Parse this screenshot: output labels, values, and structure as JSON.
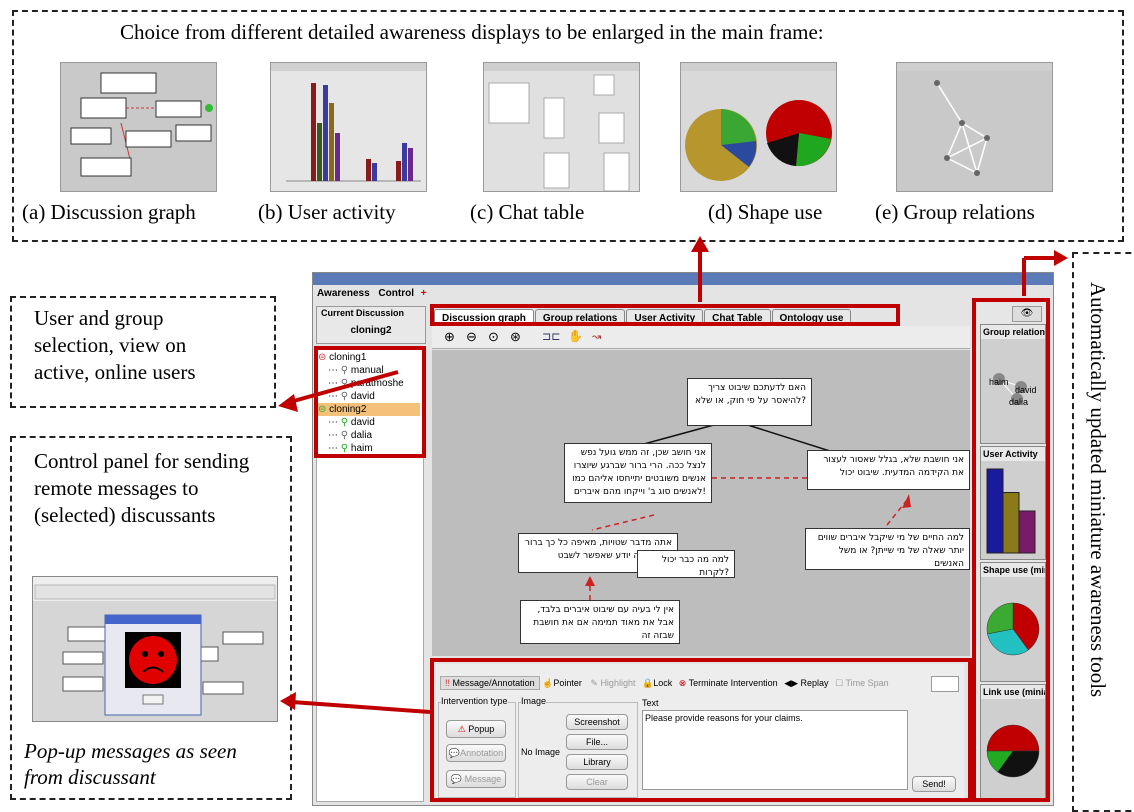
{
  "top_caption": "Choice from different detailed awareness displays to be enlarged in the main frame:",
  "thumbnails": [
    {
      "caption": "(a) Discussion graph"
    },
    {
      "caption": "(b) User activity"
    },
    {
      "caption": "(c) Chat table"
    },
    {
      "caption": "(d) Shape use"
    },
    {
      "caption": "(e) Group relations"
    }
  ],
  "annotations": {
    "user_group": "User and group selection, view on active, online users",
    "control_panel": "Control panel for sending remote messages to (selected) discussants",
    "popup_caption": "Pop-up messages as seen from discussant",
    "right_vertical": "Automatically updated miniature awareness tools"
  },
  "app": {
    "menu": [
      "Awareness",
      "Control"
    ],
    "current_discussion_label": "Current Discussion",
    "current_discussion": "cloning2",
    "tree": [
      {
        "label": "cloning1",
        "children": [
          "manual",
          "paratmoshe",
          "david"
        ]
      },
      {
        "label": "cloning2",
        "children": [
          "david",
          "dalia",
          "haim"
        ]
      }
    ],
    "tabs": [
      "Discussion graph",
      "Group relations",
      "User Activity",
      "Chat Table",
      "Ontology use"
    ],
    "nodes": [
      "האם לדעתכם שיבוט צריך להיאסר על פי חוק, או שלא?",
      "אני חושב שכן, זה ממש גועל נפש לנצל ככה. הרי ברור שברגע שיוצרו אנשים משובטים יתייחסו אליהם כמו לאנשים סוג ב' וייקחו מהם איברים!",
      "אני חושבת שלא, בגלל שאסור לעצור את הקידמה המדעית. שיבוט יכול",
      "אתה מדבר שטויות, מאיפה כל כך ברור מזה, אתה יודע שאפשר לשבט",
      "למה מה כבר יכול לקרות?",
      "למה החיים של מי שיקבל איברים שווים יותר שאלה של מי שייתן? או משל האנשים",
      "אין לי בעיה עם שיבוט איברים בלבד, אבל את מאוד תמימה אם את חושבת שבזה זה"
    ],
    "control": {
      "tabs": [
        "Message/Annotation",
        "Pointer",
        "Highlight",
        "Lock",
        "Terminate Intervention",
        "Replay",
        "Time Span"
      ],
      "intervention_type_label": "Intervention type",
      "types": [
        "Popup",
        "Annotation",
        "Message"
      ],
      "image_label": "Image",
      "no_image": "No Image",
      "image_buttons": [
        "Screenshot",
        "File...",
        "Library",
        "Clear"
      ],
      "text_label": "Text",
      "text_value": "Please provide reasons for your claims.",
      "send": "Send!"
    },
    "side": [
      {
        "title": "Group relations",
        "users": [
          "haim",
          "david",
          "dalia"
        ]
      },
      {
        "title": "User Activity"
      },
      {
        "title": "Shape use (minia"
      },
      {
        "title": "Link use (miniat"
      }
    ]
  },
  "chart_data": [
    {
      "type": "bar",
      "title": "User Activity",
      "values": [
        1.0,
        0.72,
        0.5
      ],
      "colors": [
        "#1a1a9c",
        "#8b7a1a",
        "#7a1a6b"
      ]
    },
    {
      "type": "pie",
      "title": "Shape use",
      "values": [
        40,
        32,
        28
      ],
      "colors": [
        "#c00000",
        "#22c0c0",
        "#3aaa33"
      ]
    },
    {
      "type": "pie",
      "title": "Link use",
      "values": [
        50,
        35,
        15
      ],
      "colors": [
        "#c00000",
        "#111111",
        "#22aa22"
      ]
    }
  ],
  "colors": {
    "accent": "#c00000"
  }
}
